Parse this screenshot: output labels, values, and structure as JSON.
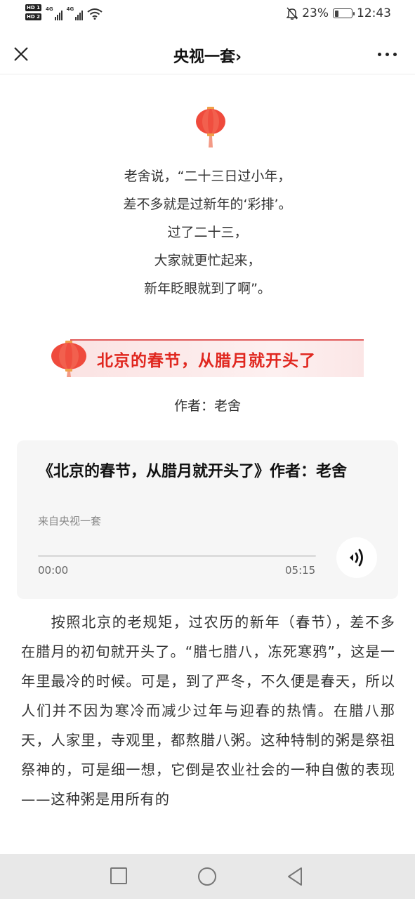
{
  "status_bar": {
    "hd_badges": [
      "HD 1",
      "HD 2"
    ],
    "network_1": "4G",
    "network_2": "4G",
    "battery_percent": "23%",
    "battery_level": 0.23,
    "time": "12:43",
    "icons": [
      "signal-icon",
      "wifi-icon",
      "mute-icon",
      "battery-icon"
    ]
  },
  "nav": {
    "title": "央视一套",
    "chevron": "›",
    "icons": [
      "close-icon",
      "more-icon"
    ]
  },
  "poem": {
    "lines": [
      "老舍说，“二十三日过小年，",
      "差不多就是过新年的‘彩排’。",
      "过了二十三，",
      "大家就更忙起来，",
      "新年眨眼就到了啊”。"
    ]
  },
  "banner": {
    "text": "北京的春节，从腊月就开头了"
  },
  "author": "作者：老舍",
  "audio": {
    "title": "《北京的春节，从腊月就开头了》作者：老舍",
    "source": "来自央视一套",
    "time_start": "00:00",
    "time_end": "05:15",
    "progress": 0
  },
  "body": "按照北京的老规矩，过农历的新年（春节），差不多在腊月的初旬就开头了。“腊七腊八，冻死寒鸦”，这是一年里最冷的时候。可是，到了严冬，不久便是春天，所以人们并不因为寒冷而减少过年与迎春的热情。在腊八那天，人家里，寺观里，都熬腊八粥。这种特制的粥是祭祖祭神的，可是细一想，它倒是农业社会的一种自傲的表现——这种粥是用所有的",
  "colors": {
    "accent_red": "#e0271f",
    "card_bg": "#f6f6f6",
    "sys_nav_bg": "#e8e8e8"
  }
}
